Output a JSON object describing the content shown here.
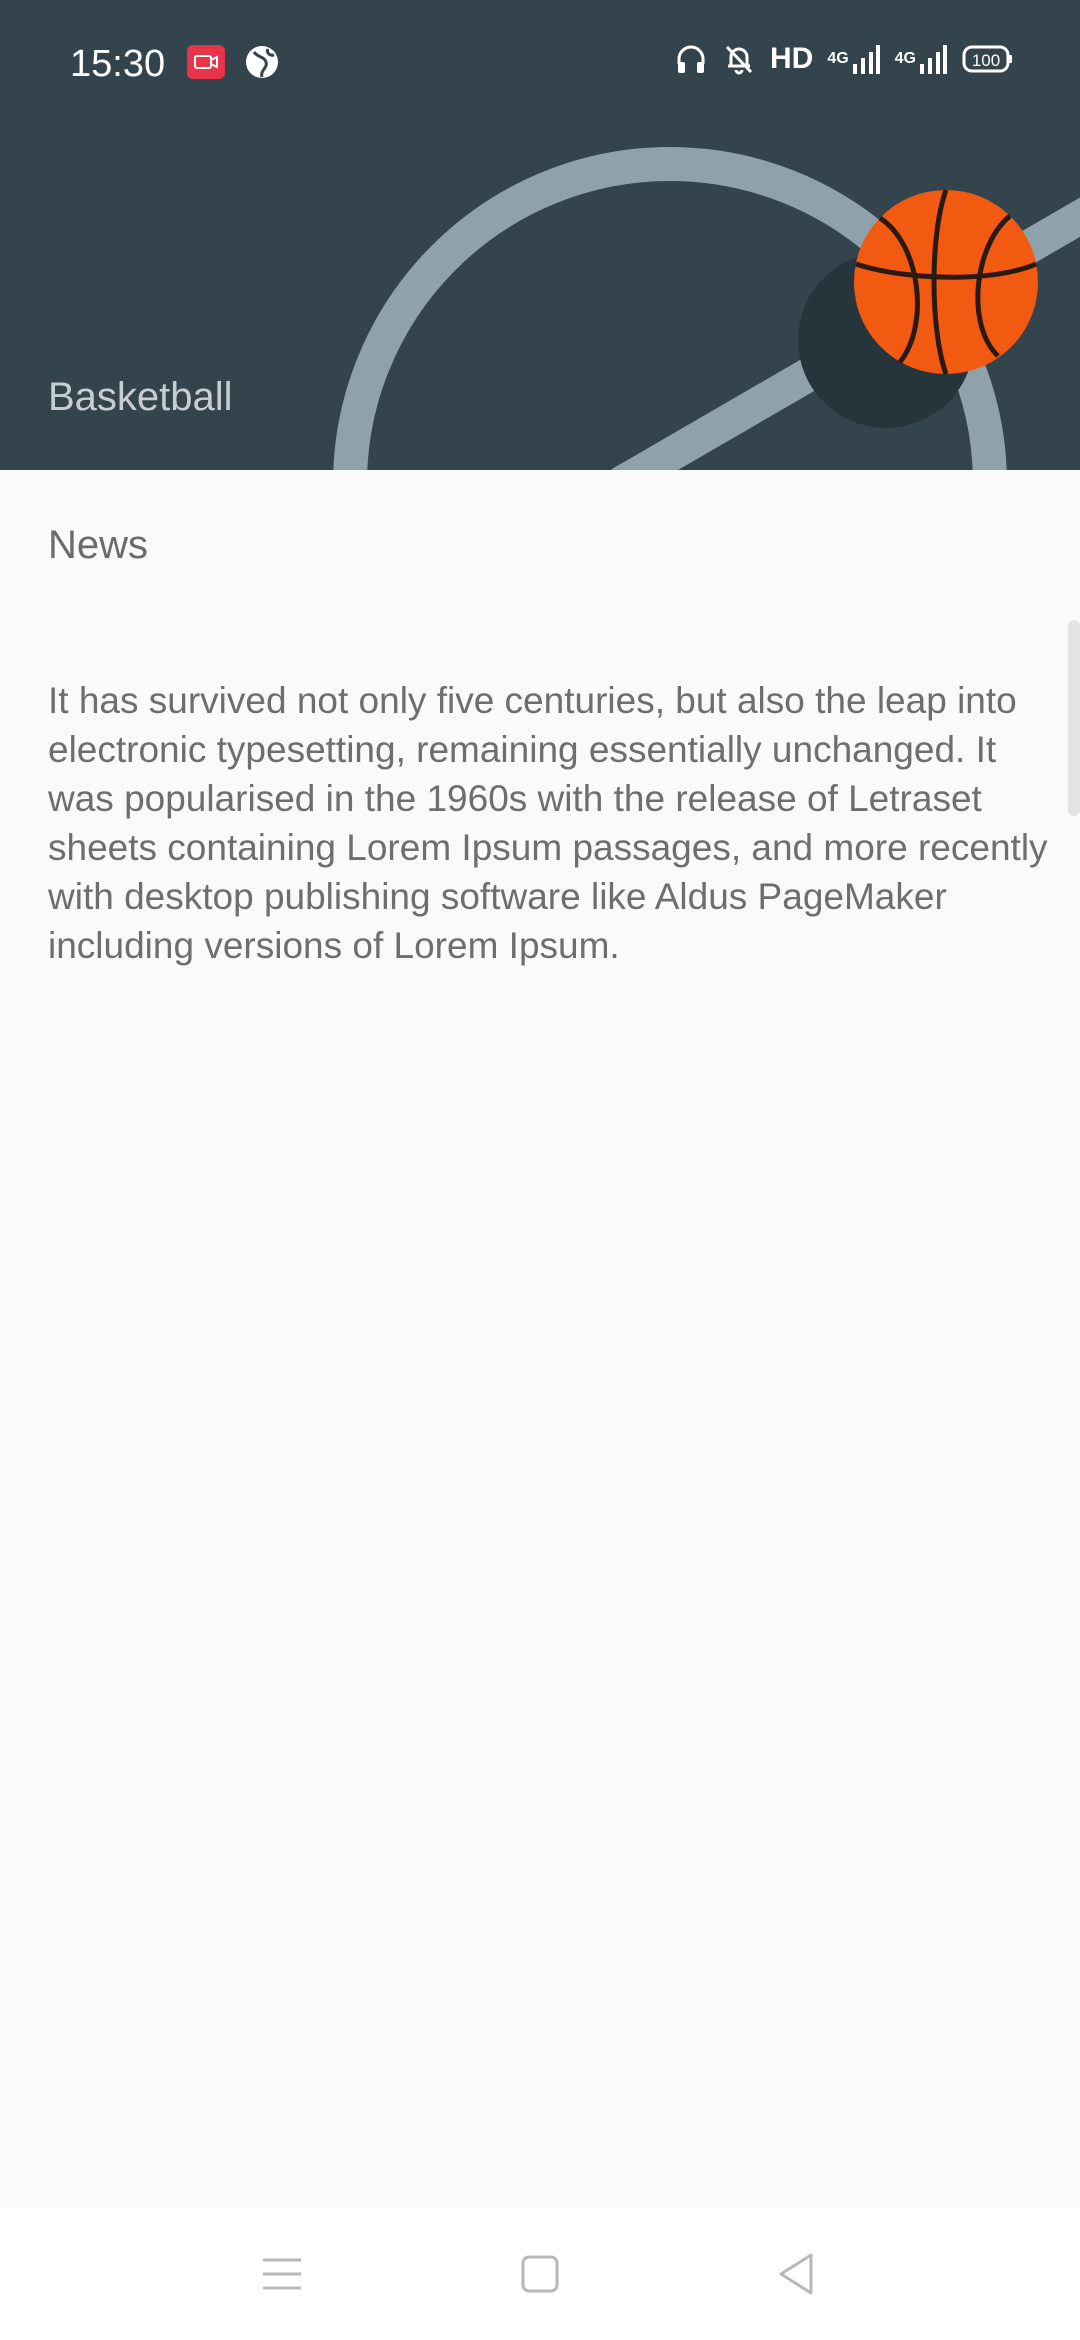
{
  "status_bar": {
    "time": "15:30",
    "left_icons": [
      "screen-record-icon",
      "globe-icon"
    ],
    "right_icons": [
      "headphones-icon",
      "bell-off-icon",
      "hd-icon",
      "signal-4g-icon",
      "signal-4g-icon",
      "battery-icon"
    ],
    "hd_label": "HD",
    "network_label": "4G",
    "battery_level": "100"
  },
  "header": {
    "title": "Basketball"
  },
  "content": {
    "section_title": "News",
    "body": "It has survived not only five centuries, but also the leap into electronic typesetting, remaining essentially unchanged. It was popularised in the 1960s with the release of Letraset sheets containing Lorem Ipsum passages, and more recently with desktop publishing software like Aldus PageMaker including versions of Lorem Ipsum."
  },
  "nav_bar": {
    "buttons": [
      "menu-icon",
      "home-icon",
      "back-icon"
    ]
  },
  "colors": {
    "header_bg": "#34444d",
    "ball": "#f25a12",
    "court_line": "#8fa1ab"
  }
}
